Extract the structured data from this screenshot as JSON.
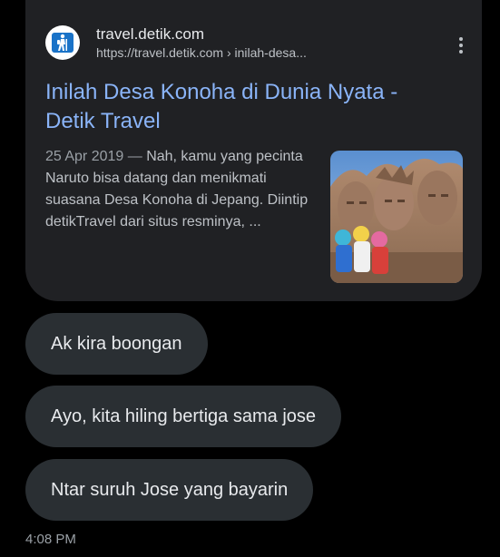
{
  "link_card": {
    "site_name": "travel.detik.com",
    "url": "https://travel.detik.com › inilah-desa...",
    "title": "Inilah Desa Konoha di Dunia Nyata - Detik Travel",
    "date": "25 Apr 2019",
    "separator": " — ",
    "snippet": "Nah, kamu yang pecinta Naruto bisa datang dan menikmati suasana Desa Konoha di Jepang. Diintip detikTravel dari situs resminya, ...",
    "menu_icon": "more-vert-icon",
    "favicon": "hiker-icon",
    "favicon_color": "#1a73c8",
    "title_color": "#8ab4f8"
  },
  "messages": [
    {
      "text": "Ak kira boongan"
    },
    {
      "text": "Ayo, kita hiling bertiga sama jose"
    },
    {
      "text": "Ntar suruh Jose yang bayarin"
    }
  ],
  "timestamp": "4:08 PM",
  "colors": {
    "background": "#000000",
    "card": "#202124",
    "bubble": "#2a2f33"
  }
}
